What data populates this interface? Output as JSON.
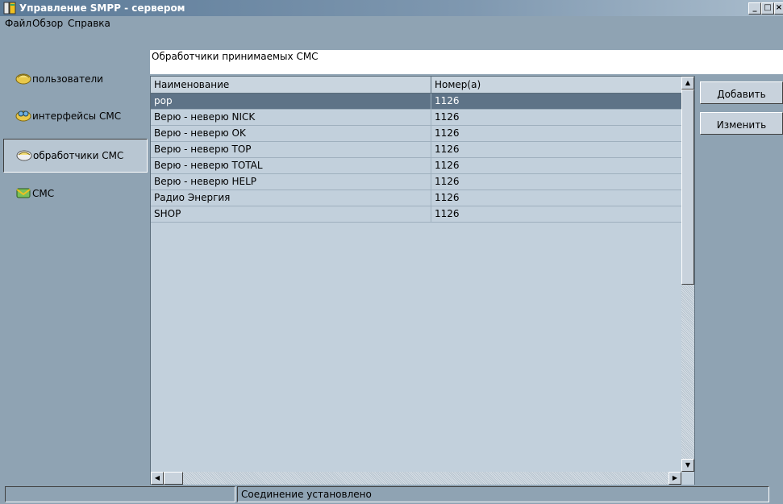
{
  "window": {
    "title": "Управление SMPP - сервером",
    "minimize_glyph": "_",
    "maximize_glyph": "□",
    "close_glyph": "×"
  },
  "menu": [
    "Файл",
    "Обзор",
    "Справка"
  ],
  "sidebar": {
    "items": [
      {
        "label": "пользователи",
        "icon": "users-icon"
      },
      {
        "label": "интерфейсы СМС",
        "icon": "interfaces-icon"
      },
      {
        "label": "обработчики СМС",
        "icon": "handlers-icon",
        "selected": true
      },
      {
        "label": "СМС",
        "icon": "sms-icon"
      }
    ]
  },
  "section_label": "Обработчики принимаемых СМС",
  "table": {
    "columns": [
      "Наименование",
      "Номер(а)"
    ],
    "rows": [
      {
        "name": "pop",
        "number": "1126",
        "selected": true
      },
      {
        "name": "Верю - неверю NICK",
        "number": "1126"
      },
      {
        "name": "Верю - неверю OK",
        "number": "1126"
      },
      {
        "name": "Верю - неверю TOP",
        "number": "1126"
      },
      {
        "name": "Верю - неверю TOTAL",
        "number": "1126"
      },
      {
        "name": "Верю - неверю HELP",
        "number": "1126"
      },
      {
        "name": "Радио Энергия",
        "number": "1126"
      },
      {
        "name": "SHOP",
        "number": "1126"
      }
    ]
  },
  "actions": {
    "add_label": "Добавить",
    "edit_label": "Изменить"
  },
  "status": {
    "connection": "Соединение установлено"
  },
  "colors": {
    "background": "#8fa3b3",
    "selected_row": "#5e7387",
    "table_bg": "#c2d0dc"
  }
}
